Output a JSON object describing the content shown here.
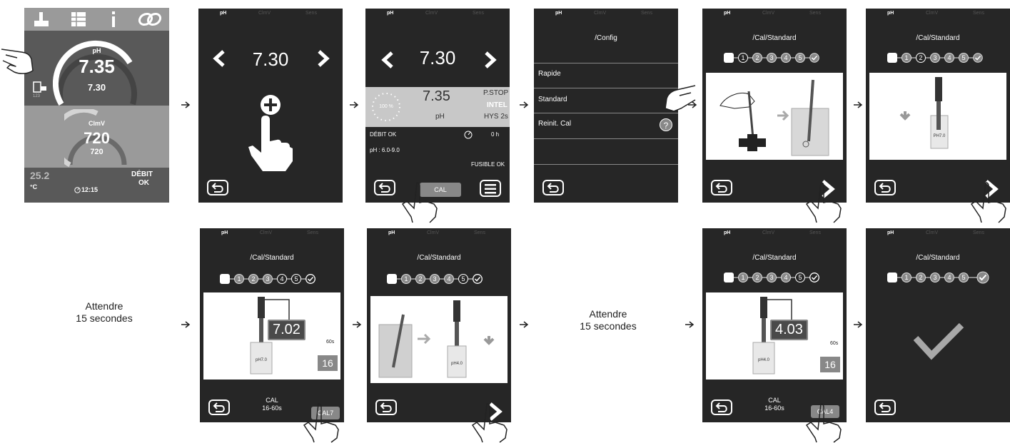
{
  "tabs": {
    "ph": "pH",
    "clmv": "ClmV",
    "sens": "Sens"
  },
  "home": {
    "ph_label": "pH",
    "ph_value": "7.35",
    "ph_set": "7.30",
    "ph_icon_sub": "123",
    "cl_label": "ClmV",
    "cl_value": "720",
    "cl_set": "720",
    "temp_value": "25.2",
    "temp_unit": "°C",
    "flow_line1": "DÉBIT",
    "flow_line2": "OK",
    "clock": "12:15"
  },
  "s2": {
    "value": "7.30"
  },
  "s3": {
    "value": "7.30",
    "dial_pct": "100 %",
    "ph_meas": "7.35",
    "ph_label": "pH",
    "pstop": "P.STOP",
    "intel": "INTEL",
    "hys": "HYS 2s",
    "flow": "DÉBIT OK",
    "hours": "0 h",
    "range": "pH : 6.0-9.0",
    "fuse": "FUSIBLE OK",
    "cal": "CAL"
  },
  "s4": {
    "title": "/Config",
    "menu": [
      "Rapide",
      "Standard",
      "Reinit. Cal"
    ],
    "help": "?"
  },
  "cal_title": "/Cal/Standard",
  "steps": [
    "1",
    "2",
    "3",
    "4",
    "5"
  ],
  "buffers": {
    "ph7": "PH7.0",
    "ph7b": "pH7.0",
    "ph4": "pH4.0"
  },
  "wait_text": {
    "line1": "Attendre",
    "line2": "15 secondes"
  },
  "s7": {
    "reading": "7.02",
    "sec": "60s",
    "timer": "16",
    "cal1": "CAL",
    "cal2": "16-60s",
    "btn": "CAL7"
  },
  "s10": {
    "reading": "4.03",
    "sec": "60s",
    "timer": "16",
    "cal1": "CAL",
    "cal2": "16-60s",
    "btn": "CAL4"
  },
  "colors": {
    "screen": "#262626",
    "grey": "#888888",
    "white": "#ffffff"
  }
}
